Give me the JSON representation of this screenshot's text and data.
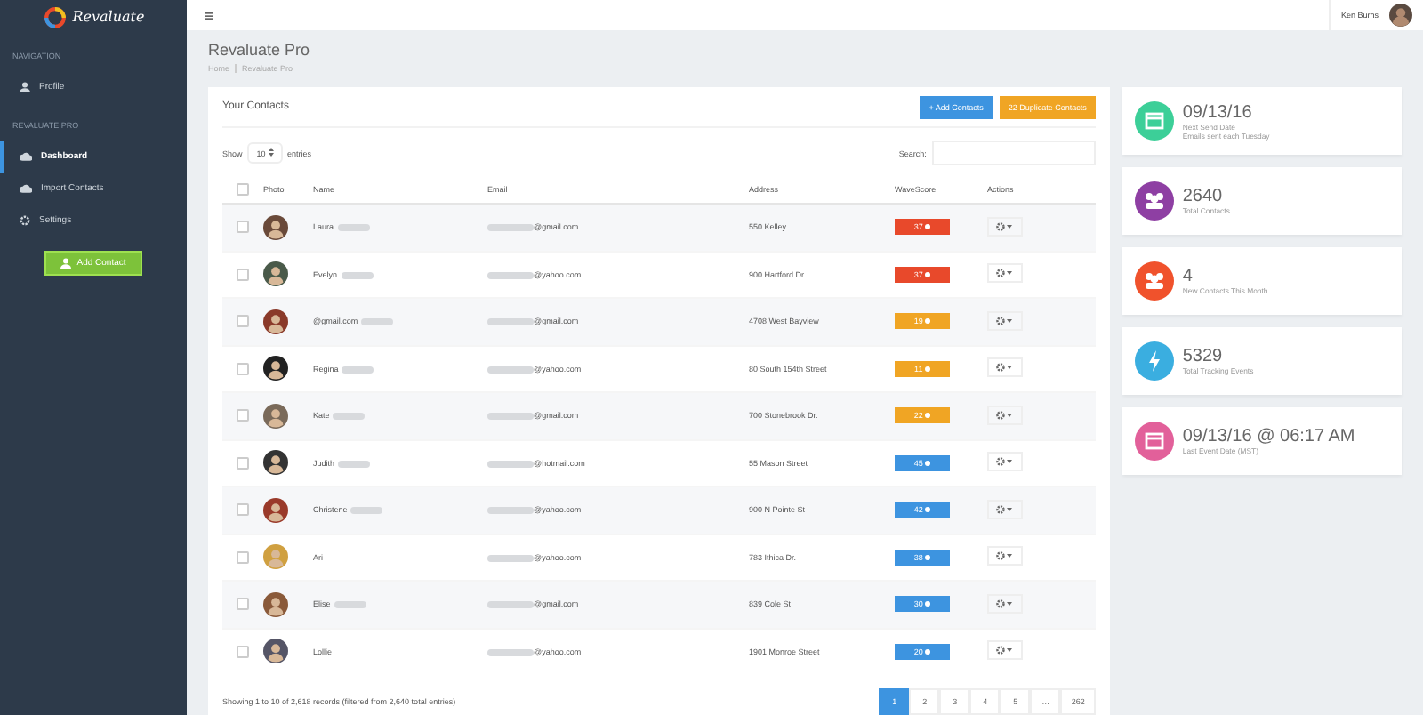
{
  "sidebar": {
    "logo": "Revaluate",
    "sections": [
      {
        "heading": "NAVIGATION",
        "items": [
          {
            "label": "Profile",
            "kind": "user",
            "selected": false
          }
        ]
      },
      {
        "heading": "REVALUATE PRO",
        "items": [
          {
            "label": "Dashboard",
            "kind": "cloud",
            "selected": true
          },
          {
            "label": "Import Contacts",
            "kind": "cloud",
            "selected": false
          },
          {
            "label": "Settings",
            "kind": "gear",
            "selected": false
          }
        ]
      }
    ],
    "button": "Add Contact"
  },
  "topbar": {
    "menu": "≡",
    "user": "Ken Burns"
  },
  "page": {
    "title": "Revaluate Pro",
    "breadcrumb": [
      "Home",
      "Revaluate Pro"
    ]
  },
  "contacts": {
    "title": "Your Contacts",
    "buttons": [
      {
        "label": "+ Add Contacts",
        "kind": "primary"
      },
      {
        "label": "22 Duplicate Contacts",
        "kind": "warning"
      }
    ],
    "show": "Show",
    "entries_value": "10",
    "entries": "entries",
    "search_label": "Search:",
    "select_all_checked": false,
    "columns": [
      "Photo",
      "Name",
      "Email",
      "Address",
      "WaveScore",
      "Actions"
    ],
    "rows": [
      {
        "checked": false,
        "name": "Laura",
        "redacted_name": true,
        "email": "@gmail.com",
        "address": "550 Kelley",
        "score": "37",
        "color": "#e8492b"
      },
      {
        "checked": false,
        "name": "Evelyn",
        "redacted_name": true,
        "email": "@yahoo.com",
        "address": "900 Hartford Dr.",
        "score": "37",
        "color": "#e8492b"
      },
      {
        "checked": false,
        "name": "@gmail.com",
        "redacted_name": true,
        "email": "@gmail.com",
        "address": "4708 West Bayview",
        "score": "19",
        "color": "#f0a524"
      },
      {
        "checked": false,
        "name": "Regina",
        "redacted_name": true,
        "email": "@yahoo.com",
        "address": "80 South 154th Street",
        "score": "11",
        "color": "#f0a524"
      },
      {
        "checked": false,
        "name": "Kate",
        "redacted_name": true,
        "email": "@gmail.com",
        "address": "700 Stonebrook Dr.",
        "score": "22",
        "color": "#f0a524"
      },
      {
        "checked": false,
        "name": "Judith",
        "redacted_name": true,
        "email": "@hotmail.com",
        "address": "55 Mason Street",
        "score": "45",
        "color": "#3d94e0"
      },
      {
        "checked": false,
        "name": "Christene",
        "redacted_name": true,
        "email": "@yahoo.com",
        "address": "900 N Pointe St",
        "score": "42",
        "color": "#3d94e0"
      },
      {
        "checked": false,
        "name": "Ari",
        "redacted_name": false,
        "email": "@yahoo.com",
        "address": "783 Ithica Dr.",
        "score": "38",
        "color": "#3d94e0"
      },
      {
        "checked": false,
        "name": "Elise",
        "redacted_name": true,
        "email": "@gmail.com",
        "address": "839 Cole St",
        "score": "30",
        "color": "#3d94e0"
      },
      {
        "checked": false,
        "name": "Lollie",
        "redacted_name": false,
        "email": "@yahoo.com",
        "address": "1901 Monroe Street",
        "score": "20",
        "color": "#3d94e0"
      }
    ],
    "footer": "Showing 1 to 10 of 2,618 records (filtered from 2,640 total entries)",
    "pages": [
      {
        "label": "1",
        "selected": true
      },
      {
        "label": "2",
        "selected": false
      },
      {
        "label": "3",
        "selected": false
      },
      {
        "label": "4",
        "selected": false
      },
      {
        "label": "5",
        "selected": false
      },
      {
        "label": "…",
        "selected": false
      },
      {
        "label": "262",
        "selected": false
      }
    ]
  },
  "stats": [
    {
      "value": "09/13/16",
      "label": "Next Send Date",
      "note": "Emails sent each Tuesday",
      "kind": "calendar",
      "color": "#3ccf98"
    },
    {
      "value": "2640",
      "label": "Total Contacts",
      "kind": "users",
      "color": "#8e3fa3"
    },
    {
      "value": "4",
      "label": "New Contacts This Month",
      "kind": "users",
      "color": "#f0522c"
    },
    {
      "value": "5329",
      "label": "Total Tracking Events",
      "kind": "bolt",
      "color": "#3aaee0"
    },
    {
      "value": "09/13/16 @ 06:17 AM",
      "label": "Last Event Date (MST)",
      "kind": "calendar",
      "color": "#e2609a"
    }
  ]
}
